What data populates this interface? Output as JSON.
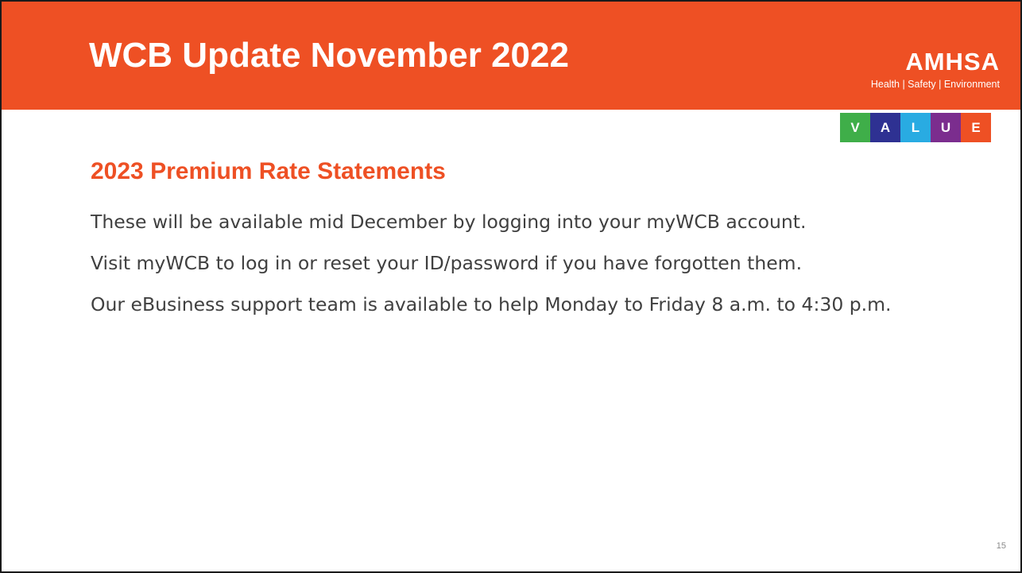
{
  "header": {
    "title": "WCB Update November 2022"
  },
  "logo": {
    "wordmark": "AMHSA",
    "tagline": "Health | Safety | Environment"
  },
  "value_strip": [
    {
      "letter": "V",
      "color": "#3fae49"
    },
    {
      "letter": "A",
      "color": "#2e3192"
    },
    {
      "letter": "L",
      "color": "#29abe2"
    },
    {
      "letter": "U",
      "color": "#7b2d8e"
    },
    {
      "letter": "E",
      "color": "#ee5024"
    }
  ],
  "section": {
    "title": "2023 Premium Rate Statements",
    "paragraphs": [
      "These will be available mid December by logging into your myWCB account.",
      "Visit myWCB to log in or reset your ID/password if you have forgotten them.",
      "Our eBusiness support team is available to help Monday to Friday 8 a.m. to 4:30 p.m."
    ]
  },
  "footer": {
    "page_number": "15"
  },
  "colors": {
    "accent": "#ee5024",
    "body_text": "#404040"
  }
}
